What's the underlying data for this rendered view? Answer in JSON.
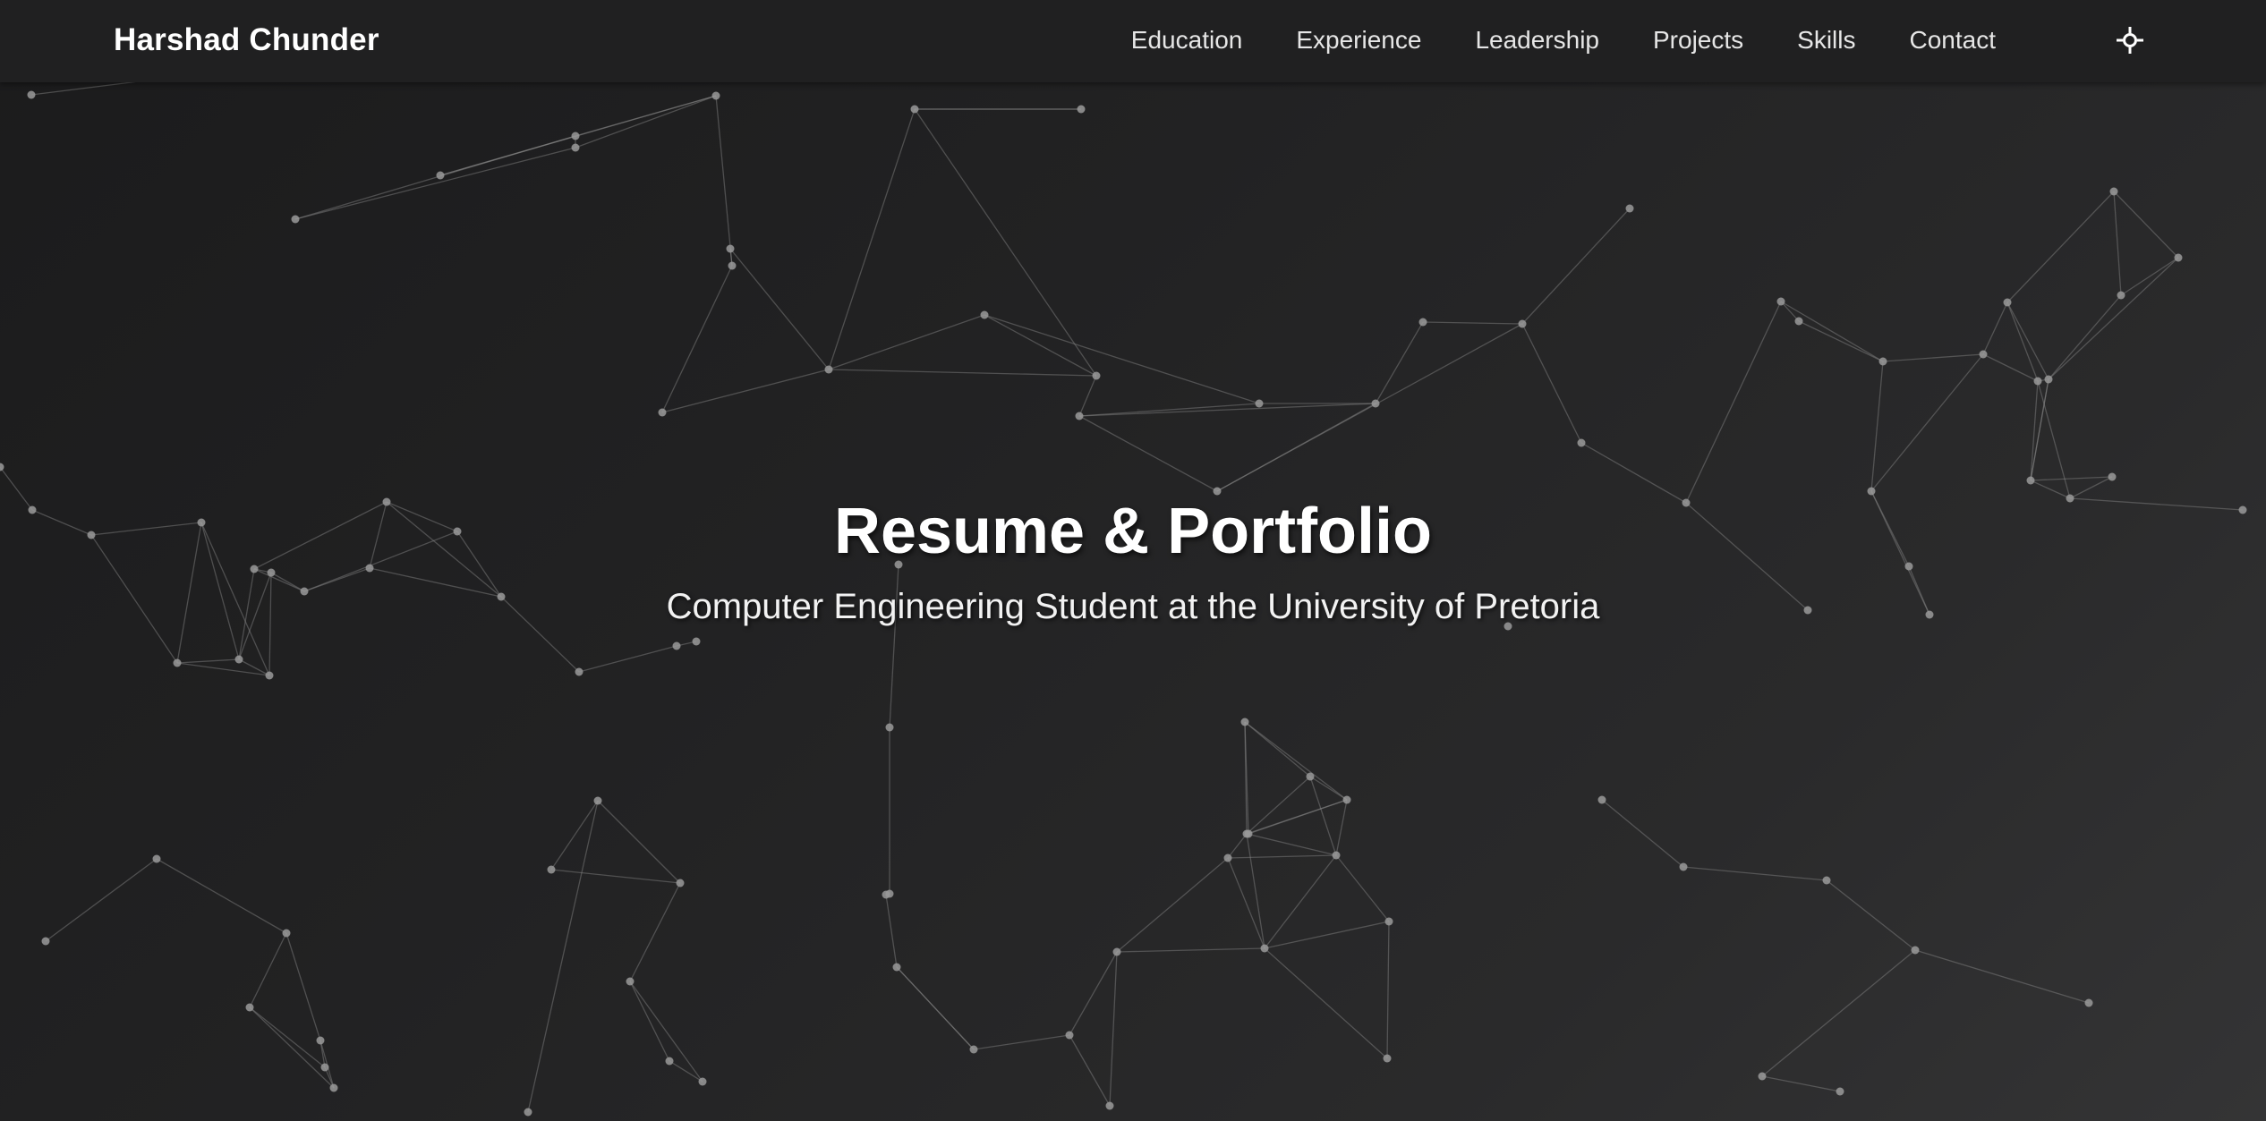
{
  "navbar": {
    "brand": "Harshad Chunder",
    "links": [
      {
        "label": "Education"
      },
      {
        "label": "Experience"
      },
      {
        "label": "Leadership"
      },
      {
        "label": "Projects"
      },
      {
        "label": "Skills"
      },
      {
        "label": "Contact"
      }
    ],
    "theme_toggle_icon": "sun-icon"
  },
  "hero": {
    "title": "Resume & Portfolio",
    "subtitle": "Computer Engineering Student at the University of Pretoria"
  },
  "background": {
    "effect": "particle-network",
    "colors": {
      "background_dark": "#1b1b1c",
      "background_light": "#343435",
      "nodes": "#9a9a9a",
      "links": "#8a8a8a"
    }
  }
}
